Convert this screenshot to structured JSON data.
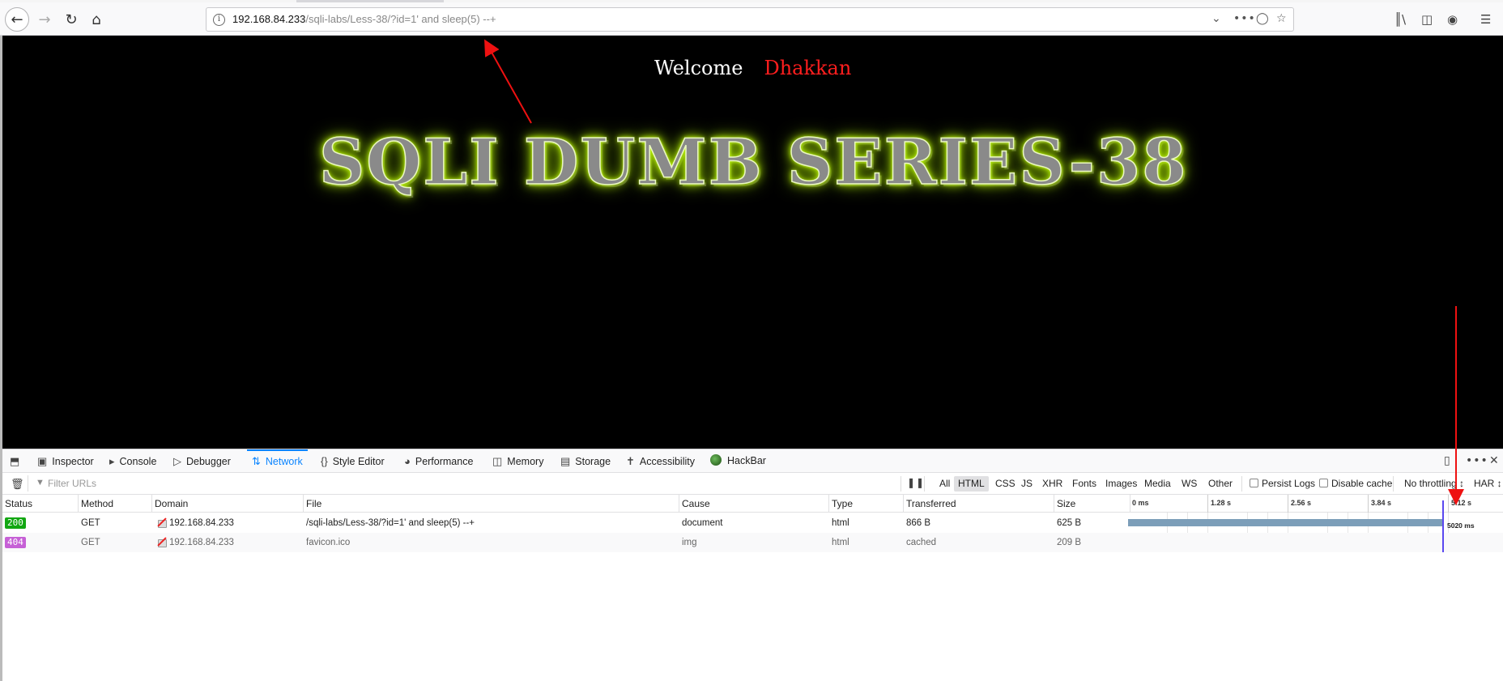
{
  "browser": {
    "url_host": "192.168.84.233",
    "url_rest": "/sqli-labs/Less-38/?id=1' and sleep(5) --+"
  },
  "page": {
    "welcome": "Welcome",
    "name": "Dhakkan",
    "banner": "SQLI DUMB SERIES-38"
  },
  "devtools": {
    "tabs": [
      "Inspector",
      "Console",
      "Debugger",
      "Network",
      "Style Editor",
      "Performance",
      "Memory",
      "Storage",
      "Accessibility",
      "HackBar"
    ],
    "active_tab": "Network",
    "filter_placeholder": "Filter URLs",
    "type_filters": [
      "All",
      "HTML",
      "CSS",
      "JS",
      "XHR",
      "Fonts",
      "Images",
      "Media",
      "WS",
      "Other"
    ],
    "active_filter": "HTML",
    "persist_logs": "Persist Logs",
    "disable_cache": "Disable cache",
    "throttling": "No throttling ↕",
    "har": "HAR ↕"
  },
  "network": {
    "columns": [
      "Status",
      "Method",
      "Domain",
      "File",
      "Cause",
      "Type",
      "Transferred",
      "Size"
    ],
    "timeline_ticks": [
      "0 ms",
      "1.28 s",
      "2.56 s",
      "3.84 s",
      "5.12 s"
    ],
    "rows": [
      {
        "status": "200",
        "method": "GET",
        "domain": "192.168.84.233",
        "file": "/sqli-labs/Less-38/?id=1' and sleep(5) --+",
        "cause": "document",
        "type": "html",
        "transferred": "866 B",
        "size": "625 B",
        "timing": "5020 ms",
        "duration_ms": 5020
      },
      {
        "status": "404",
        "method": "GET",
        "domain": "192.168.84.233",
        "file": "favicon.ico",
        "cause": "img",
        "type": "html",
        "transferred": "cached",
        "size": "209 B"
      }
    ]
  },
  "colors": {
    "accent": "#0a84ff",
    "status_ok": "#12a712",
    "status_404": "#c660d6",
    "annotation_arrow": "#ee1111"
  }
}
